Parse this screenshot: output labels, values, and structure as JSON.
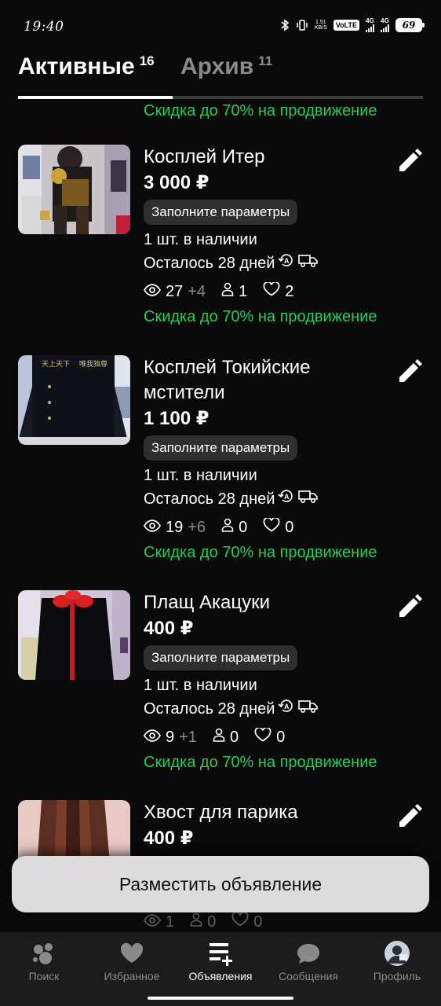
{
  "status_bar": {
    "time": "19:40",
    "speed": "1.51",
    "speed_unit": "KB/S",
    "volte": "VoLTE",
    "sim1": "4G",
    "sim2": "4G",
    "battery": "69"
  },
  "tabs": [
    {
      "label": "Активные",
      "count": "16",
      "active": true
    },
    {
      "label": "Архив",
      "count": "11",
      "active": false
    }
  ],
  "promo_top": "Скидка до 70% на продвижение",
  "items": [
    {
      "title": "Косплей Итер",
      "price": "3 000 ₽",
      "chip": "Заполните параметры",
      "stock": "1 шт. в наличии",
      "remaining": "Осталось 28 дней",
      "views": "27",
      "views_new": "+4",
      "contacts": "1",
      "likes": "2",
      "promo": "Скидка до 70% на продвижение"
    },
    {
      "title": "Косплей Токийские мстители",
      "price": "1 100 ₽",
      "chip": "Заполните параметры",
      "stock": "1 шт. в наличии",
      "remaining": "Осталось 28 дней",
      "views": "19",
      "views_new": "+6",
      "contacts": "0",
      "likes": "0",
      "promo": "Скидка до 70% на продвижение"
    },
    {
      "title": "Плащ Акацуки",
      "price": "400 ₽",
      "chip": "Заполните параметры",
      "stock": "1 шт. в наличии",
      "remaining": "Осталось 28 дней",
      "views": "9",
      "views_new": "+1",
      "contacts": "0",
      "likes": "0",
      "promo": "Скидка до 70% на продвижение"
    },
    {
      "title": "Хвост для парика",
      "price": "400 ₽",
      "views": "1",
      "contacts": "0",
      "likes": "0"
    }
  ],
  "place_ad_button": "Разместить объявление",
  "nav": [
    {
      "label": "Поиск",
      "icon": "search-bubbles-icon",
      "active": false
    },
    {
      "label": "Избранное",
      "icon": "heart-icon",
      "active": false
    },
    {
      "label": "Объявления",
      "icon": "listings-add-icon",
      "active": true
    },
    {
      "label": "Сообщения",
      "icon": "chat-icon",
      "active": false
    },
    {
      "label": "Профиль",
      "icon": "avatar",
      "active": false
    }
  ],
  "colors": {
    "background": "#0a0a0a",
    "promo_green": "#23d05b",
    "chip": "#2f2f2f",
    "nav_bg": "#1c1c1c"
  }
}
